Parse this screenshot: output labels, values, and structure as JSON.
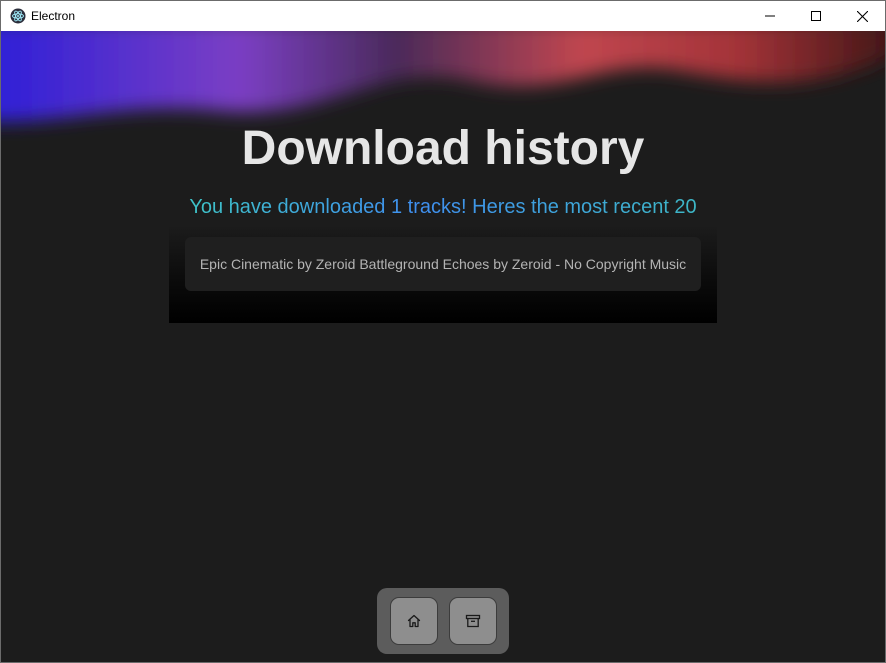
{
  "window": {
    "title": "Electron"
  },
  "page": {
    "heading": "Download history",
    "subheading": "You have downloaded 1 tracks! Heres the most recent 20"
  },
  "history": {
    "tracks_text": "Epic Cinematic by Zeroid Battleground Echoes by Zeroid - No Copyright Music"
  },
  "nav": {
    "items": [
      {
        "icon": "home-icon"
      },
      {
        "icon": "archive-icon"
      }
    ]
  },
  "colors": {
    "background": "#1c1c1c",
    "heading": "#e6e6e6",
    "subheading_start": "#3ec3c7",
    "subheading_mid": "#3f8ff0",
    "nav_bar": "#5c5c5c",
    "nav_button": "#8e8e8e"
  }
}
